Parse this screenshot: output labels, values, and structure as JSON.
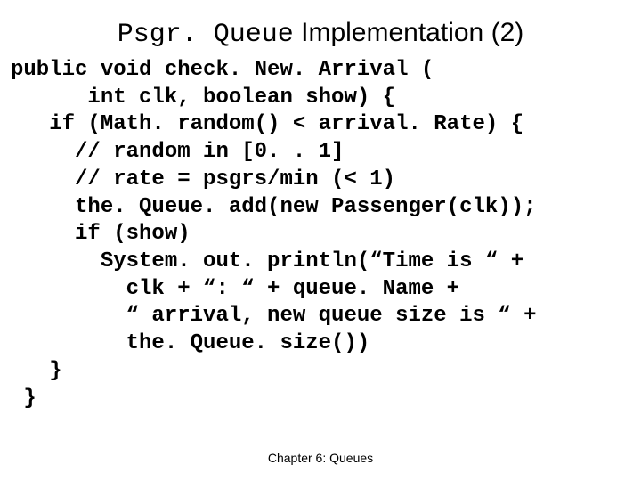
{
  "title": {
    "mono": "Psgr. Queue",
    "rest": " Implementation (2)"
  },
  "code": {
    "l1": "public void check. New. Arrival (",
    "l2": "      int clk, boolean show) {",
    "l3": "   if (Math. random() < arrival. Rate) {",
    "l4": "     // random in [0. . 1]",
    "l5": "     // rate = psgrs/min (< 1)",
    "l6": "     the. Queue. add(new Passenger(clk));",
    "l7": "     if (show)",
    "l8": "       System. out. println(“Time is “ +",
    "l9": "         clk + “: “ + queue. Name +",
    "l10": "         “ arrival, new queue size is “ +",
    "l11": "         the. Queue. size())",
    "l12": "   }",
    "l13": " }"
  },
  "footer": "Chapter 6: Queues"
}
